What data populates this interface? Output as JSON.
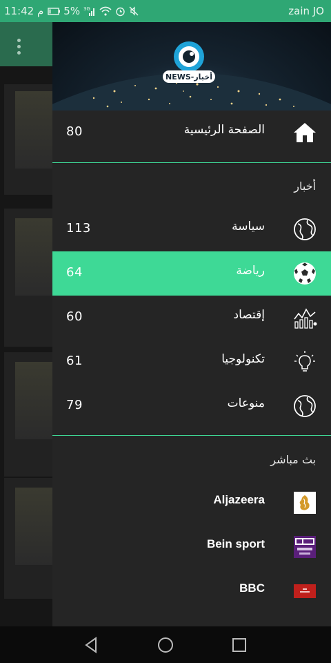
{
  "status_bar": {
    "time": "11:42 م",
    "battery": "5%",
    "carrier": "zain JO",
    "network": "3G"
  },
  "drawer": {
    "logo_text": "NEWS-أخبار",
    "home": {
      "label": "الصفحة الرئيسية",
      "count": "80",
      "icon": "home-icon"
    },
    "news_section_title": "أخبار",
    "categories": [
      {
        "label": "سياسة",
        "count": "113",
        "icon": "globe-icon",
        "active": false
      },
      {
        "label": "رياضة",
        "count": "64",
        "icon": "soccer-ball-icon",
        "active": true
      },
      {
        "label": "إقتصاد",
        "count": "60",
        "icon": "economy-chart-icon",
        "active": false
      },
      {
        "label": "تكنولوجيا",
        "count": "61",
        "icon": "lightbulb-icon",
        "active": false
      },
      {
        "label": "منوعات",
        "count": "79",
        "icon": "globe-icon",
        "active": false
      }
    ],
    "live_section_title": "بث مباشر",
    "channels": [
      {
        "label": "Aljazeera",
        "icon": "aljazeera-logo"
      },
      {
        "label": "Bein sport",
        "icon": "bein-sports-logo"
      },
      {
        "label": "BBC",
        "icon": "bbc-logo"
      }
    ]
  },
  "colors": {
    "accent": "#3ed996",
    "status_bar": "#2fa774",
    "drawer_bg": "#252525"
  }
}
